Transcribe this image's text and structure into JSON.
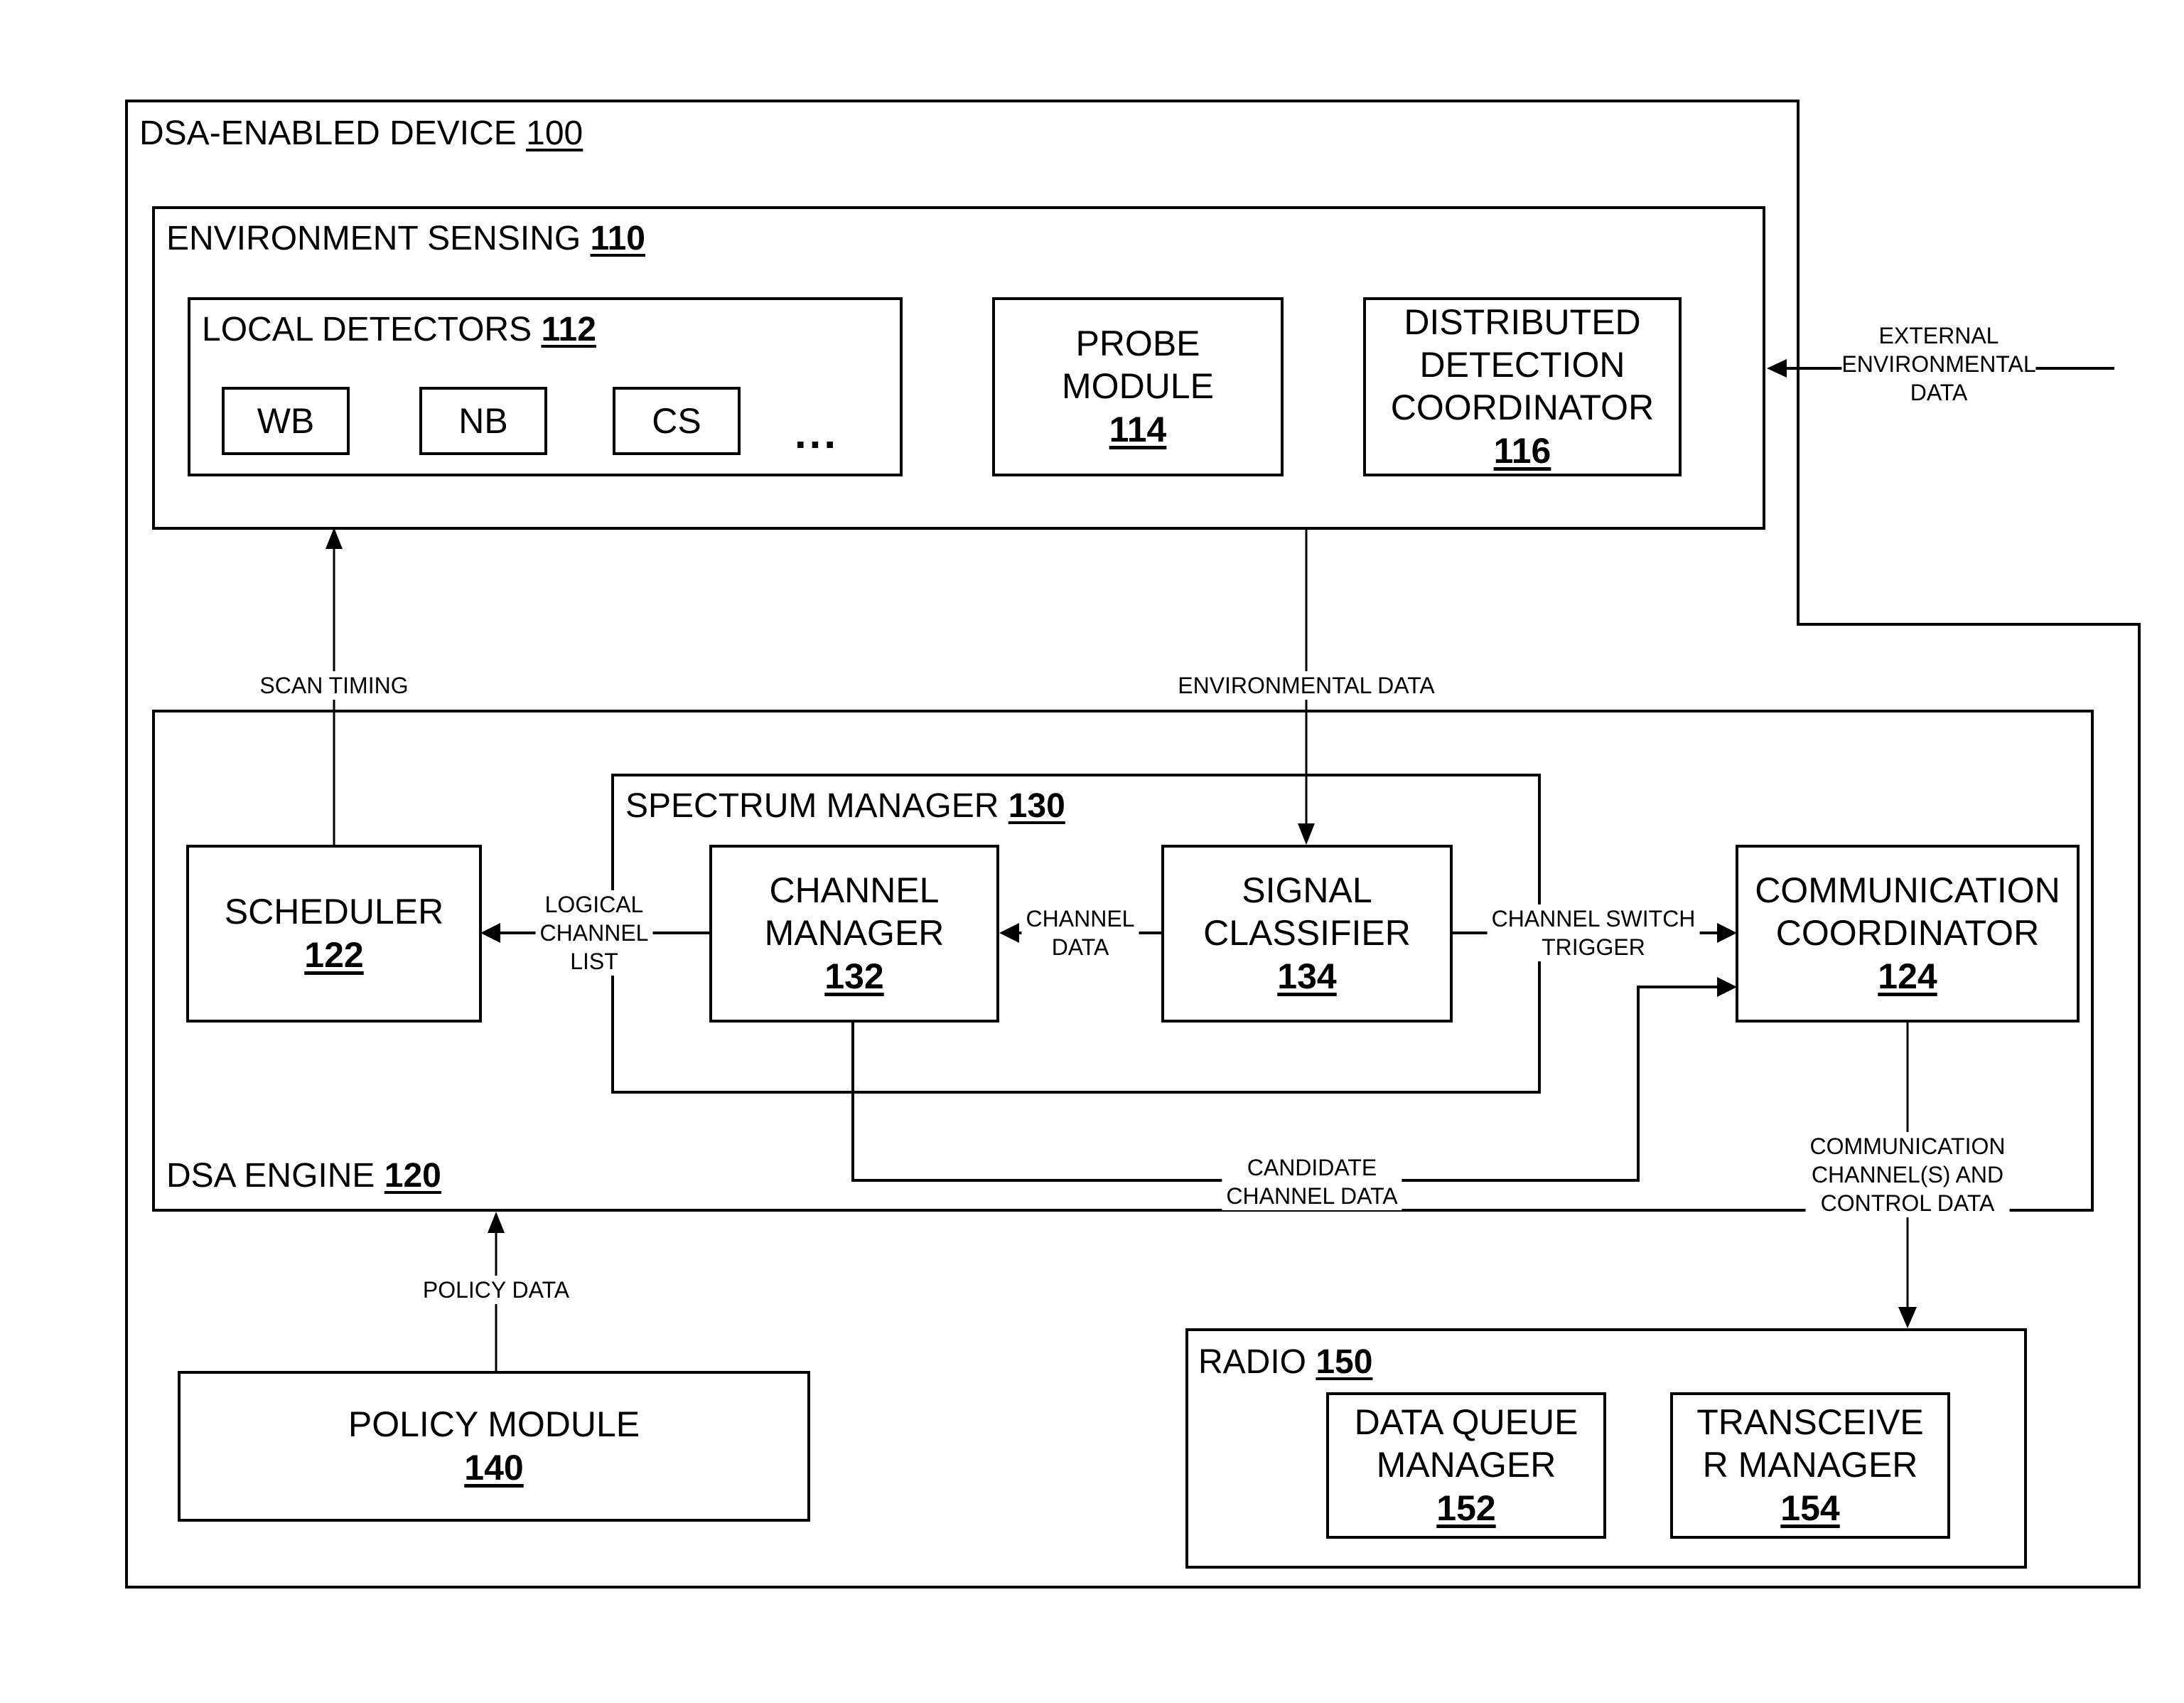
{
  "device": {
    "label": "DSA-ENABLED DEVICE",
    "ref": "100"
  },
  "environment_sensing": {
    "label": "ENVIRONMENT SENSING",
    "ref": "110",
    "local_detectors": {
      "label": "LOCAL DETECTORS",
      "ref": "112",
      "detectors": [
        "WB",
        "NB",
        "CS"
      ],
      "more": "..."
    },
    "probe_module": {
      "lines": [
        "PROBE",
        "MODULE"
      ],
      "ref": "114"
    },
    "distributed_detection": {
      "lines": [
        "DISTRIBUTED",
        "DETECTION",
        "COORDINATOR"
      ],
      "ref": "116"
    }
  },
  "dsa_engine": {
    "label": "DSA ENGINE",
    "ref": "120",
    "scheduler": {
      "lines": [
        "SCHEDULER"
      ],
      "ref": "122"
    },
    "communication_coordinator": {
      "lines": [
        "COMMUNICATION",
        "COORDINATOR"
      ],
      "ref": "124"
    },
    "spectrum_manager": {
      "label": "SPECTRUM MANAGER",
      "ref": "130",
      "channel_manager": {
        "lines": [
          "CHANNEL",
          "MANAGER"
        ],
        "ref": "132"
      },
      "signal_classifier": {
        "lines": [
          "SIGNAL",
          "CLASSIFIER"
        ],
        "ref": "134"
      }
    }
  },
  "policy_module": {
    "lines": [
      "POLICY MODULE"
    ],
    "ref": "140"
  },
  "radio": {
    "label": "RADIO",
    "ref": "150",
    "data_queue_manager": {
      "lines": [
        "DATA QUEUE",
        "MANAGER"
      ],
      "ref": "152"
    },
    "transceiver_manager": {
      "lines": [
        "TRANSCEIVE",
        "R MANAGER"
      ],
      "ref": "154"
    }
  },
  "edges": {
    "external_environmental_data": [
      "EXTERNAL",
      "ENVIRONMENTAL",
      "DATA"
    ],
    "scan_timing": [
      "SCAN TIMING"
    ],
    "environmental_data": [
      "ENVIRONMENTAL DATA"
    ],
    "logical_channel_list": [
      "LOGICAL",
      "CHANNEL",
      "LIST"
    ],
    "channel_data": [
      "CHANNEL",
      "DATA"
    ],
    "channel_switch_trigger": [
      "CHANNEL SWITCH",
      "TRIGGER"
    ],
    "candidate_channel_data": [
      "CANDIDATE",
      "CHANNEL DATA"
    ],
    "communication_control_data": [
      "COMMUNICATION",
      "CHANNEL(S) AND",
      "CONTROL DATA"
    ],
    "policy_data": [
      "POLICY DATA"
    ]
  }
}
